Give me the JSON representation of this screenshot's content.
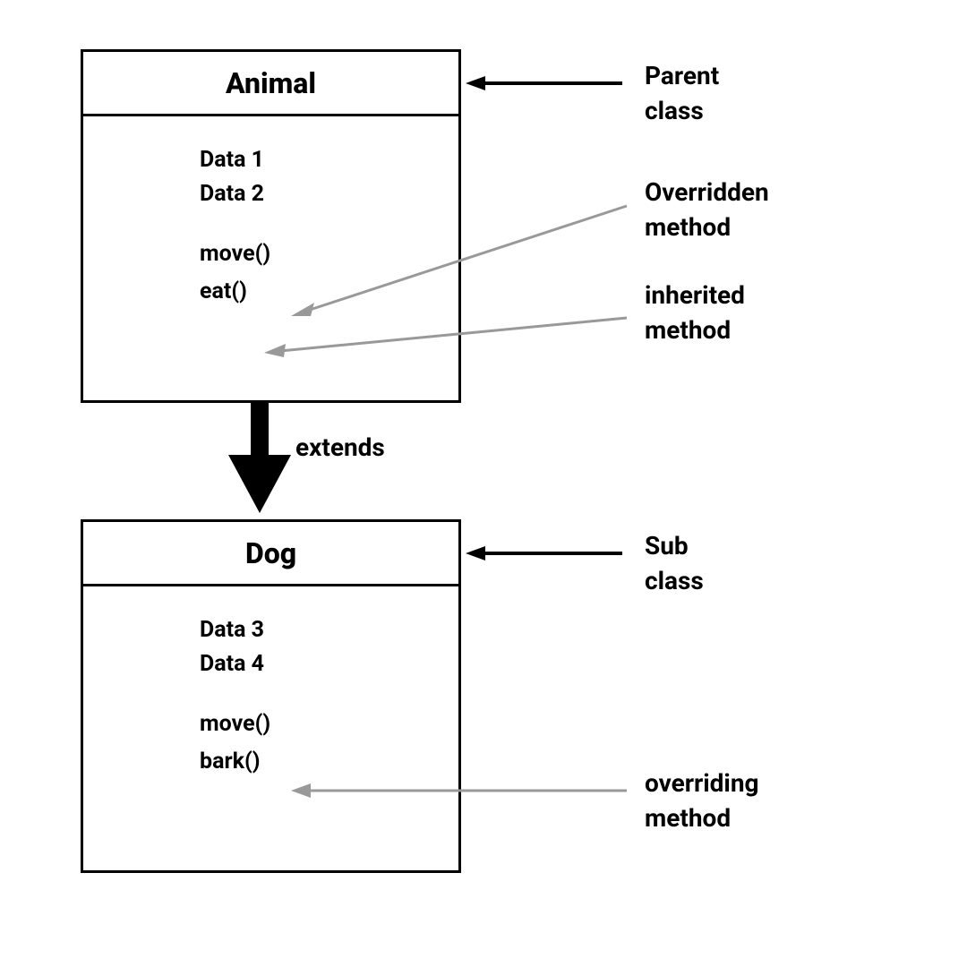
{
  "parent_class": {
    "name": "Animal",
    "data_members": [
      "Data 1",
      "Data 2"
    ],
    "methods": [
      "move()",
      "eat()"
    ]
  },
  "child_class": {
    "name": "Dog",
    "data_members": [
      "Data 3",
      "Data 4"
    ],
    "methods": [
      "move()",
      "bark()"
    ]
  },
  "labels": {
    "parent_class_line1": "Parent",
    "parent_class_line2": "class",
    "overridden_line1": "Overridden",
    "overridden_line2": "method",
    "inherited_line1": "inherited",
    "inherited_line2": "method",
    "extends": "extends",
    "sub_class_line1": "Sub",
    "sub_class_line2": "class",
    "overriding_line1": "overriding",
    "overriding_line2": "method"
  },
  "relationship": "extends"
}
